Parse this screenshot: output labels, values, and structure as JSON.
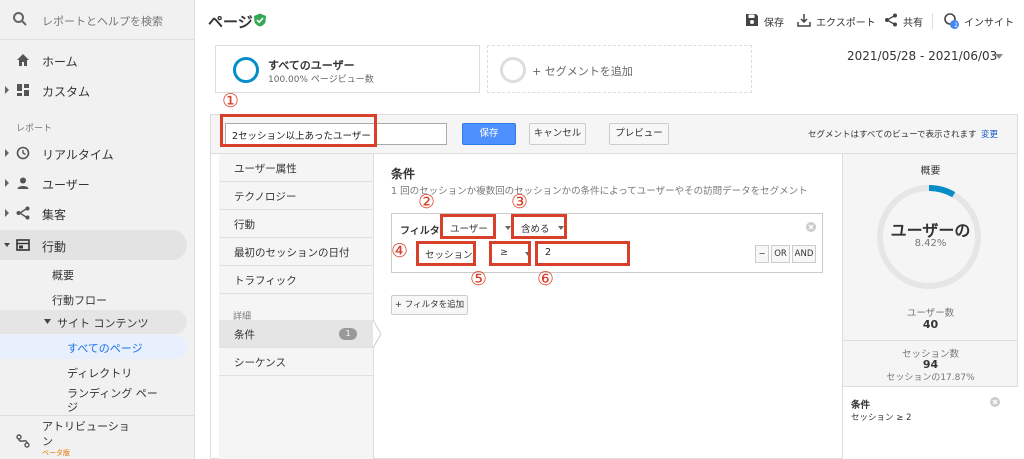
{
  "sidebar": {
    "search_placeholder": "レポートとヘルプを検索",
    "home": "ホーム",
    "custom": "カスタム",
    "reports_section": "レポート",
    "realtime": "リアルタイム",
    "audience": "ユーザー",
    "acquisition": "集客",
    "behavior": "行動",
    "behavior_sub": {
      "overview": "概要",
      "flow": "行動フロー",
      "site_content": "サイト コンテンツ",
      "all_pages": "すべてのページ",
      "directory": "ディレクトリ",
      "landing_1": "ランディング ペー",
      "landing_2": "ジ"
    },
    "attribution_1": "アトリビューショ",
    "attribution_2": "ン",
    "beta": "ベータ版"
  },
  "header": {
    "title": "ページ",
    "save": "保存",
    "export": "エクスポート",
    "share": "共有",
    "insights": "インサイト",
    "insights_badge": "2"
  },
  "segments": {
    "all_users": "すべてのユーザー",
    "all_users_sub": "100.00% ページビュー数",
    "add_segment": "+ セグメントを追加",
    "date_range": "2021/05/28 - 2021/06/03"
  },
  "editor": {
    "segment_name": "2セッション以上あったユーザー",
    "save": "保存",
    "cancel": "キャンセル",
    "preview": "プレビュー",
    "visibility_note": "セグメントはすべてのビューで表示されます",
    "change": "変更",
    "menu": {
      "demographics": "ユーザー属性",
      "technology": "テクノロジー",
      "behavior": "行動",
      "first_session": "最初のセッションの日付",
      "traffic": "トラフィック",
      "advanced": "詳細",
      "conditions": "条件",
      "conditions_count": "1",
      "sequences": "シーケンス"
    },
    "conditions_title": "条件",
    "conditions_desc": "1 回のセッションか複数回のセッションかの条件によってユーザーやその訪問データをセグメント",
    "filter": {
      "label": "フィルタ",
      "scope": "ユーザー",
      "match": "含める",
      "dimension": "セッション",
      "operator": "≥",
      "value": "2",
      "minus": "−",
      "or": "OR",
      "and": "AND"
    },
    "add_filter": "+ フィルタを追加"
  },
  "summary": {
    "title": "概要",
    "gauge_label": "ユーザーの",
    "gauge_pct": "8.42%",
    "users_label": "ユーザー数",
    "users_value": "40",
    "sessions_label": "セッション数",
    "sessions_value": "94",
    "sessions_pct": "セッションの17.87%",
    "gauge_fraction": 0.0842,
    "card_title": "条件",
    "card_desc": "セッション ≥ 2"
  },
  "annotations": {
    "n1": "①",
    "n2": "②",
    "n3": "③",
    "n4": "④",
    "n5": "⑤",
    "n6": "⑥"
  },
  "colors": {
    "accent_blue": "#058dc7",
    "save_button": "#4d90fe",
    "annotation_red": "#d9402c",
    "verified_green": "#34a853"
  }
}
